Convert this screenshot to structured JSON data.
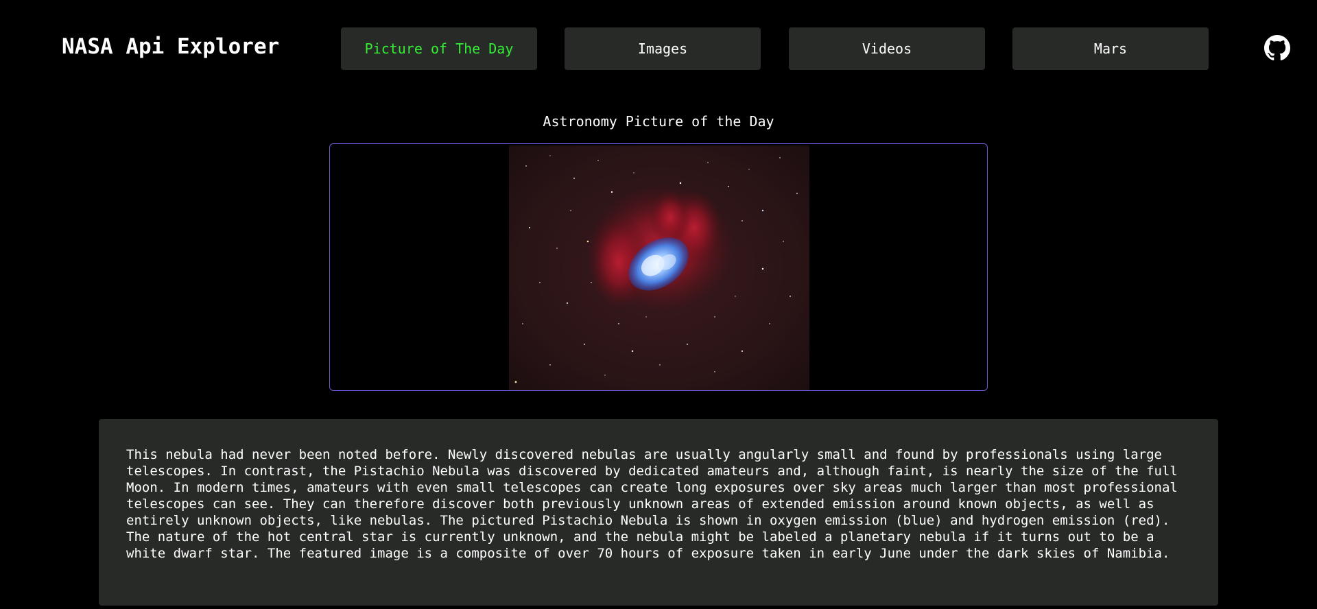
{
  "header": {
    "brand": "NASA Api Explorer",
    "nav": [
      {
        "label": "Picture of The Day",
        "active": true
      },
      {
        "label": "Images",
        "active": false
      },
      {
        "label": "Videos",
        "active": false
      },
      {
        "label": "Mars",
        "active": false
      }
    ],
    "github_icon": "github-icon"
  },
  "apod": {
    "section_title": "Astronomy Picture of the Day",
    "image_icon": "nebula-image",
    "description": "This nebula had never been noted before. Newly discovered nebulas are usually angularly small and found by professionals using large telescopes. In contrast, the Pistachio Nebula was discovered by dedicated amateurs and, although faint, is nearly the size of the full Moon. In modern times, amateurs with even small telescopes can create long exposures over sky areas much larger than most professional telescopes can see. They can therefore discover both previously unknown areas of extended emission around known objects, as well as entirely unknown objects, like nebulas. The pictured Pistachio Nebula is shown in oxygen emission (blue) and hydrogen emission (red). The nature of the hot central star is currently unknown, and the nebula might be labeled a planetary nebula if it turns out to be a white dwarf star. The featured image is a composite of over 70 hours of exposure taken in early June under the dark skies of Namibia."
  },
  "colors": {
    "background": "#000000",
    "panel": "#282a28",
    "active_nav": "#33ee33",
    "frame_border": "#6b5bd6"
  }
}
